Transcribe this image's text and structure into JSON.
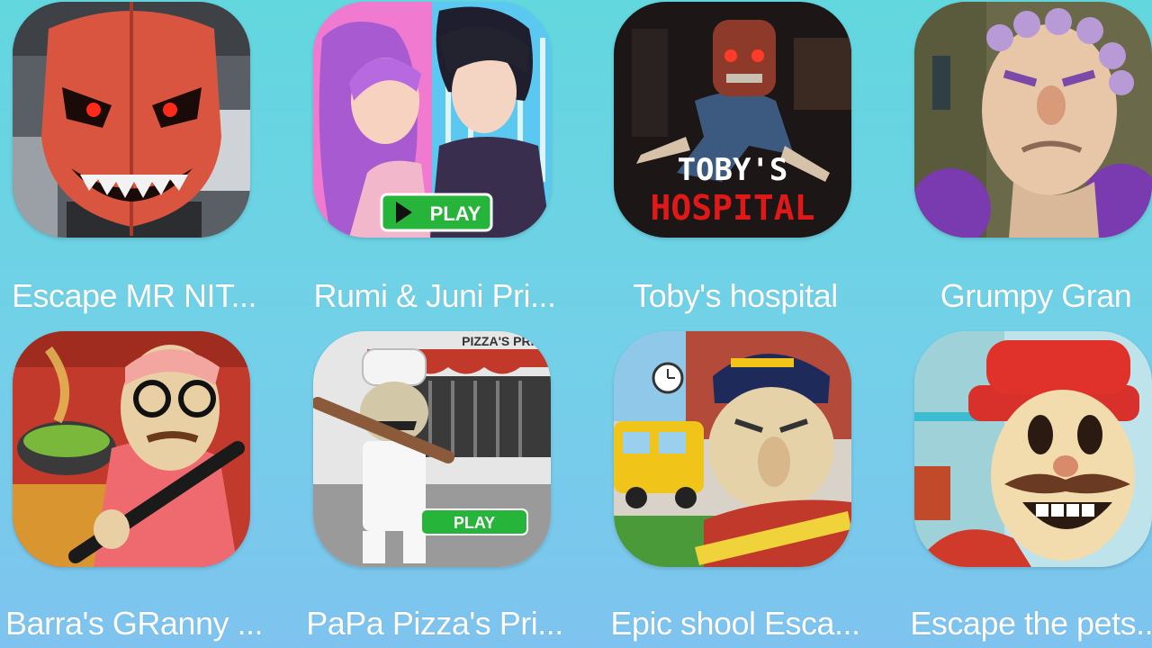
{
  "games": [
    {
      "title": "Escape MR NIT...",
      "icon": "red-mask-monster-icon"
    },
    {
      "title": "Rumi & Juni Pri...",
      "icon": "anime-couple-icon",
      "badge": "PLAY"
    },
    {
      "title": "Toby's hospital",
      "icon": "toby-hospital-icon",
      "overlay_line1": "TOBY'S",
      "overlay_line2": "HOSPITAL"
    },
    {
      "title": "Grumpy Gran",
      "icon": "grumpy-granny-icon"
    },
    {
      "title": "Barra's GRanny ...",
      "icon": "granny-bat-icon"
    },
    {
      "title": "PaPa Pizza's Pri...",
      "icon": "papa-pizza-chef-icon",
      "badge": "PLAY",
      "sign": "PIZZA'S PRIS"
    },
    {
      "title": "Epic shool Esca...",
      "icon": "school-teacher-icon"
    },
    {
      "title": "Escape the pets...",
      "icon": "mustache-man-icon"
    }
  ],
  "colors": {
    "background_top": "#62d7de",
    "background_bottom": "#7ec3ef",
    "label_text": "#ffffff",
    "play_badge": "#27b43a"
  }
}
